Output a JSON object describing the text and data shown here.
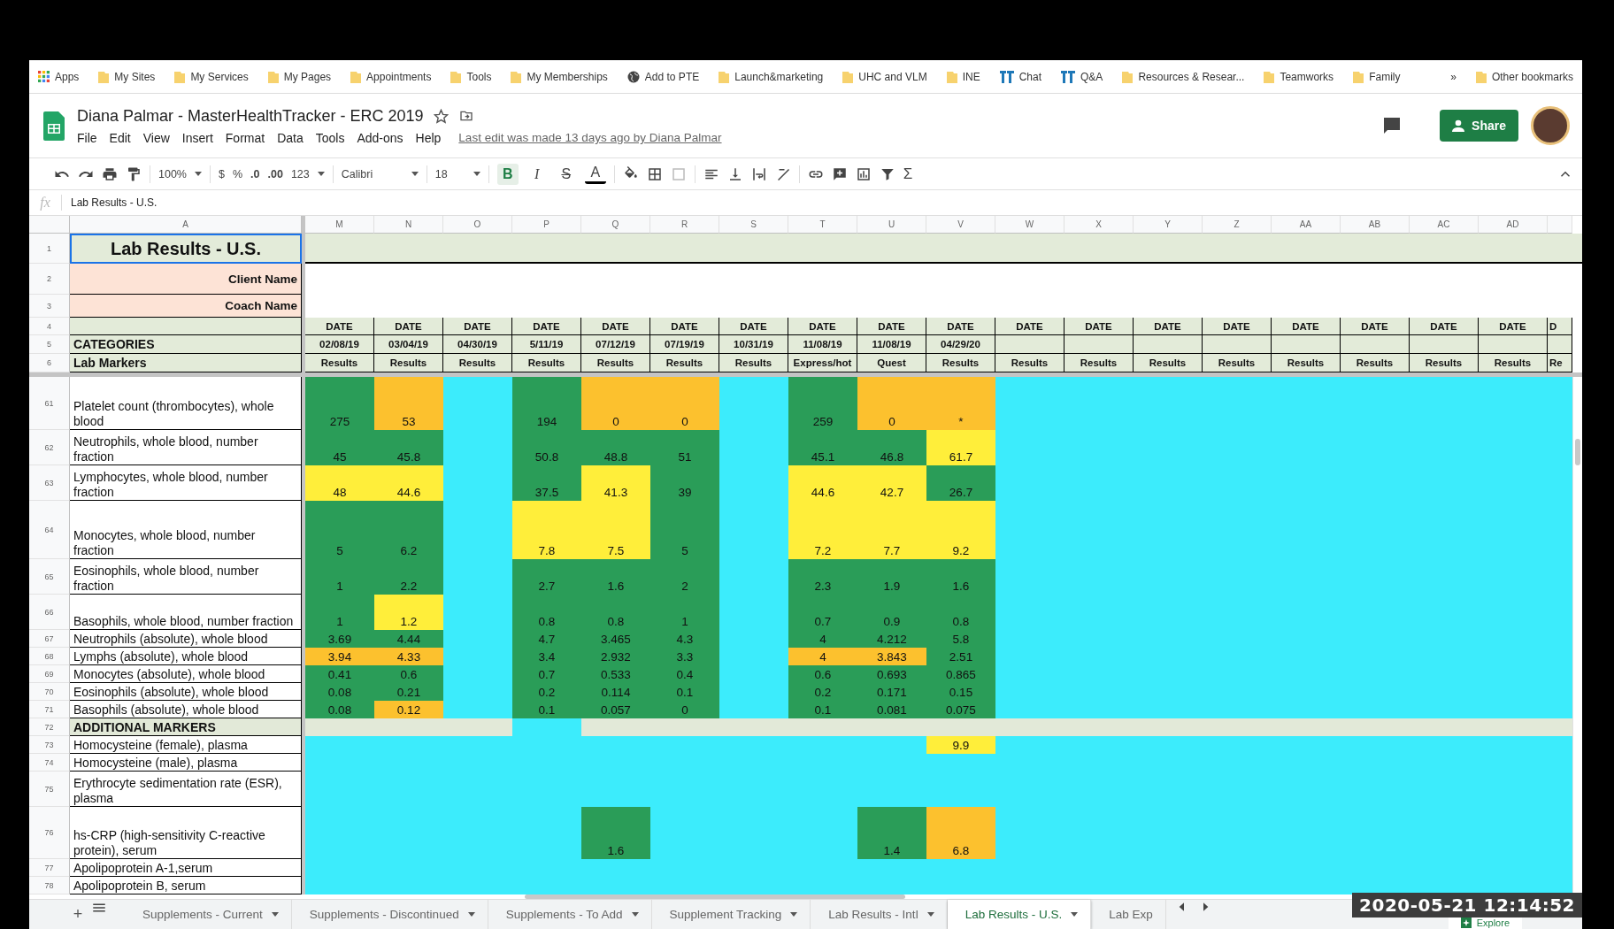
{
  "bookmarks": [
    {
      "label": "Apps",
      "kind": "apps"
    },
    {
      "label": "My Sites",
      "kind": "folder"
    },
    {
      "label": "My Services",
      "kind": "folder"
    },
    {
      "label": "My Pages",
      "kind": "folder"
    },
    {
      "label": "Appointments",
      "kind": "folder"
    },
    {
      "label": "Tools",
      "kind": "folder"
    },
    {
      "label": "My Memberships",
      "kind": "folder"
    },
    {
      "label": "Add to PTE",
      "kind": "globe"
    },
    {
      "label": "Launch&marketing",
      "kind": "folder"
    },
    {
      "label": "UHC and VLM",
      "kind": "folder"
    },
    {
      "label": "INE",
      "kind": "folder"
    },
    {
      "label": "Chat",
      "kind": "app"
    },
    {
      "label": "Q&A",
      "kind": "app"
    },
    {
      "label": "Resources & Resear...",
      "kind": "folder"
    },
    {
      "label": "Teamworks",
      "kind": "folder"
    },
    {
      "label": "Family",
      "kind": "folder"
    }
  ],
  "bookmarks_more": "»",
  "other_bookmarks": "Other bookmarks",
  "document": {
    "title": "Diana Palmar - MasterHealthTracker - ERC 2019",
    "starred": false,
    "menu": [
      "File",
      "Edit",
      "View",
      "Insert",
      "Format",
      "Data",
      "Tools",
      "Add-ons",
      "Help"
    ],
    "last_edit": "Last edit was made 13 days ago by Diana Palmar"
  },
  "share": "Share",
  "toolbar": {
    "zoom": "100%",
    "currency": "$",
    "percent": "%",
    "decrease_decimals": ".0",
    "increase_decimals": ".00",
    "number_format": "123",
    "font": "Calibri",
    "font_size": "18",
    "format_buttons": [
      {
        "label": "B",
        "kind": "bold",
        "selected": true
      },
      {
        "label": "I",
        "kind": "italic",
        "selected": false
      },
      {
        "label": "S",
        "kind": "strike",
        "selected": false
      },
      {
        "label": "A",
        "kind": "text_color",
        "selected": false
      }
    ],
    "functions": "Σ"
  },
  "formula_bar": {
    "fx": "fx",
    "content": "Lab Results - U.S."
  },
  "sheet": {
    "column_a": "A",
    "title": "Lab Results - U.S.",
    "client_label": "Client Name",
    "coach_label": "Coach Name",
    "categories": "CATEGORIES",
    "lab_markers": "Lab Markers",
    "header_row_numbers": [
      "1",
      "2",
      "3",
      "4",
      "5",
      "6"
    ],
    "columns": [
      {
        "letter": "M",
        "top": "DATE",
        "date": "02/08/19",
        "sub": "Results"
      },
      {
        "letter": "N",
        "top": "DATE",
        "date": "03/04/19",
        "sub": "Results"
      },
      {
        "letter": "O",
        "top": "DATE",
        "date": "04/30/19",
        "sub": "Results"
      },
      {
        "letter": "P",
        "top": "DATE",
        "date": "5/11/19",
        "sub": "Results"
      },
      {
        "letter": "Q",
        "top": "DATE",
        "date": "07/12/19",
        "sub": "Results"
      },
      {
        "letter": "R",
        "top": "DATE",
        "date": "07/19/19",
        "sub": "Results"
      },
      {
        "letter": "S",
        "top": "DATE",
        "date": "10/31/19",
        "sub": "Results"
      },
      {
        "letter": "T",
        "top": "DATE",
        "date": "11/08/19",
        "sub": "Express/hot"
      },
      {
        "letter": "U",
        "top": "DATE",
        "date": "11/08/19",
        "sub": "Quest"
      },
      {
        "letter": "V",
        "top": "DATE",
        "date": "04/29/20",
        "sub": "Results"
      },
      {
        "letter": "W",
        "top": "DATE",
        "sub": "Results"
      },
      {
        "letter": "X",
        "top": "DATE",
        "sub": "Results"
      },
      {
        "letter": "Y",
        "top": "DATE",
        "sub": "Results"
      },
      {
        "letter": "Z",
        "top": "DATE",
        "sub": "Results"
      },
      {
        "letter": "AA",
        "top": "DATE",
        "sub": "Results"
      },
      {
        "letter": "AB",
        "top": "DATE",
        "sub": "Results"
      },
      {
        "letter": "AC",
        "top": "DATE",
        "sub": "Results"
      },
      {
        "letter": "AD",
        "top": "DATE",
        "sub": "Results"
      },
      {
        "top": "D",
        "sub": "Re"
      }
    ],
    "rows": [
      {
        "number": "61",
        "label": "Platelet count (thrombocytes), whole blood",
        "kind": "marker",
        "cells": [
          {
            "value": "275",
            "color": "#2a9d58"
          },
          {
            "value": "53",
            "color": "#fcc12e"
          },
          "",
          {
            "value": "194",
            "color": "#2a9d58"
          },
          {
            "value": "0",
            "color": "#fcc12e"
          },
          {
            "value": "0",
            "color": "#fcc12e"
          },
          "",
          {
            "value": "259",
            "color": "#2a9d58"
          },
          {
            "value": "0",
            "color": "#fcc12e"
          },
          {
            "value": "*",
            "color": "#fcc12e"
          }
        ]
      },
      {
        "number": "62",
        "label": "Neutrophils, whole blood, number fraction",
        "kind": "marker",
        "cells": [
          {
            "value": "45",
            "color": "#2a9d58"
          },
          {
            "value": "45.8",
            "color": "#2a9d58"
          },
          "",
          {
            "value": "50.8",
            "color": "#2a9d58"
          },
          {
            "value": "48.8",
            "color": "#2a9d58"
          },
          {
            "value": "51",
            "color": "#2a9d58"
          },
          "",
          {
            "value": "45.1",
            "color": "#2a9d58"
          },
          {
            "value": "46.8",
            "color": "#2a9d58"
          },
          {
            "value": "61.7",
            "color": "#ffee3a"
          }
        ]
      },
      {
        "number": "63",
        "label": "Lymphocytes, whole blood, number fraction",
        "kind": "marker",
        "cells": [
          {
            "value": "48",
            "color": "#ffee3a"
          },
          {
            "value": "44.6",
            "color": "#ffee3a"
          },
          "",
          {
            "value": "37.5",
            "color": "#2a9d58"
          },
          {
            "value": "41.3",
            "color": "#ffee3a"
          },
          {
            "value": "39",
            "color": "#2a9d58"
          },
          "",
          {
            "value": "44.6",
            "color": "#ffee3a"
          },
          {
            "value": "42.7",
            "color": "#ffee3a"
          },
          {
            "value": "26.7",
            "color": "#2a9d58"
          }
        ]
      },
      {
        "number": "64",
        "label": "Monocytes, whole blood, number fraction",
        "kind": "marker",
        "cells": [
          {
            "value": "5",
            "color": "#2a9d58"
          },
          {
            "value": "6.2",
            "color": "#2a9d58"
          },
          "",
          {
            "value": "7.8",
            "color": "#ffee3a"
          },
          {
            "value": "7.5",
            "color": "#ffee3a"
          },
          {
            "value": "5",
            "color": "#2a9d58"
          },
          "",
          {
            "value": "7.2",
            "color": "#ffee3a"
          },
          {
            "value": "7.7",
            "color": "#ffee3a"
          },
          {
            "value": "9.2",
            "color": "#ffee3a"
          }
        ]
      },
      {
        "number": "65",
        "label": "Eosinophils, whole blood, number fraction",
        "kind": "marker",
        "cells": [
          {
            "value": "1",
            "color": "#2a9d58"
          },
          {
            "value": "2.2",
            "color": "#2a9d58"
          },
          "",
          {
            "value": "2.7",
            "color": "#2a9d58"
          },
          {
            "value": "1.6",
            "color": "#2a9d58"
          },
          {
            "value": "2",
            "color": "#2a9d58"
          },
          "",
          {
            "value": "2.3",
            "color": "#2a9d58"
          },
          {
            "value": "1.9",
            "color": "#2a9d58"
          },
          {
            "value": "1.6",
            "color": "#2a9d58"
          }
        ]
      },
      {
        "number": "66",
        "label": "Basophils, whole blood, number fraction",
        "kind": "marker",
        "cells": [
          {
            "value": "1",
            "color": "#2a9d58"
          },
          {
            "value": "1.2",
            "color": "#ffee3a"
          },
          "",
          {
            "value": "0.8",
            "color": "#2a9d58"
          },
          {
            "value": "0.8",
            "color": "#2a9d58"
          },
          {
            "value": "1",
            "color": "#2a9d58"
          },
          "",
          {
            "value": "0.7",
            "color": "#2a9d58"
          },
          {
            "value": "0.9",
            "color": "#2a9d58"
          },
          {
            "value": "0.8",
            "color": "#2a9d58"
          }
        ]
      },
      {
        "number": "67",
        "label": "Neutrophils (absolute), whole blood",
        "kind": "marker",
        "cells": [
          {
            "value": "3.69",
            "color": "#2a9d58"
          },
          {
            "value": "4.44",
            "color": "#2a9d58"
          },
          "",
          {
            "value": "4.7",
            "color": "#2a9d58"
          },
          {
            "value": "3.465",
            "color": "#2a9d58"
          },
          {
            "value": "4.3",
            "color": "#2a9d58"
          },
          "",
          {
            "value": "4",
            "color": "#2a9d58"
          },
          {
            "value": "4.212",
            "color": "#2a9d58"
          },
          {
            "value": "5.8",
            "color": "#2a9d58"
          }
        ]
      },
      {
        "number": "68",
        "label": "Lymphs (absolute), whole blood",
        "kind": "marker",
        "cells": [
          {
            "value": "3.94",
            "color": "#fcc12e"
          },
          {
            "value": "4.33",
            "color": "#fcc12e"
          },
          "",
          {
            "value": "3.4",
            "color": "#2a9d58"
          },
          {
            "value": "2.932",
            "color": "#2a9d58"
          },
          {
            "value": "3.3",
            "color": "#2a9d58"
          },
          "",
          {
            "value": "4",
            "color": "#fcc12e"
          },
          {
            "value": "3.843",
            "color": "#fcc12e"
          },
          {
            "value": "2.51",
            "color": "#2a9d58"
          }
        ]
      },
      {
        "number": "69",
        "label": "Monocytes (absolute), whole blood",
        "kind": "marker",
        "cells": [
          {
            "value": "0.41",
            "color": "#2a9d58"
          },
          {
            "value": "0.6",
            "color": "#2a9d58"
          },
          "",
          {
            "value": "0.7",
            "color": "#2a9d58"
          },
          {
            "value": "0.533",
            "color": "#2a9d58"
          },
          {
            "value": "0.4",
            "color": "#2a9d58"
          },
          "",
          {
            "value": "0.6",
            "color": "#2a9d58"
          },
          {
            "value": "0.693",
            "color": "#2a9d58"
          },
          {
            "value": "0.865",
            "color": "#2a9d58"
          }
        ]
      },
      {
        "number": "70",
        "label": "Eosinophils (absolute), whole blood",
        "kind": "marker",
        "cells": [
          {
            "value": "0.08",
            "color": "#2a9d58"
          },
          {
            "value": "0.21",
            "color": "#2a9d58"
          },
          "",
          {
            "value": "0.2",
            "color": "#2a9d58"
          },
          {
            "value": "0.114",
            "color": "#2a9d58"
          },
          {
            "value": "0.1",
            "color": "#2a9d58"
          },
          "",
          {
            "value": "0.2",
            "color": "#2a9d58"
          },
          {
            "value": "0.171",
            "color": "#2a9d58"
          },
          {
            "value": "0.15",
            "color": "#2a9d58"
          }
        ]
      },
      {
        "number": "71",
        "label": "Basophils (absolute), whole blood",
        "kind": "marker",
        "cells": [
          {
            "value": "0.08",
            "color": "#2a9d58"
          },
          {
            "value": "0.12",
            "color": "#fcc12e"
          },
          "",
          {
            "value": "0.1",
            "color": "#2a9d58"
          },
          {
            "value": "0.057",
            "color": "#2a9d58"
          },
          {
            "value": "0",
            "color": "#2a9d58"
          },
          "",
          {
            "value": "0.1",
            "color": "#2a9d58"
          },
          {
            "value": "0.081",
            "color": "#2a9d58"
          },
          {
            "value": "0.075",
            "color": "#2a9d58"
          }
        ]
      },
      {
        "number": "72",
        "label": "ADDITIONAL MARKERS",
        "kind": "section",
        "cells": [
          "",
          "",
          "",
          {
            "color": "#3cecfc"
          }
        ]
      },
      {
        "number": "73",
        "label": "Homocysteine (female), plasma",
        "kind": "marker",
        "cells": [
          "",
          "",
          "",
          "",
          "",
          "",
          "",
          "",
          "",
          {
            "value": "9.9",
            "color": "#ffee3a"
          }
        ]
      },
      {
        "number": "74",
        "label": "Homocysteine (male), plasma",
        "kind": "marker",
        "cells": []
      },
      {
        "number": "75",
        "label": "Erythrocyte sedimentation rate (ESR), plasma",
        "kind": "marker",
        "cells": []
      },
      {
        "number": "76",
        "label": "hs-CRP (high-sensitivity C-reactive protein), serum",
        "kind": "marker",
        "cells": [
          "",
          "",
          "",
          "",
          {
            "value": "1.6",
            "color": "#2a9d58"
          },
          "",
          "",
          "",
          {
            "value": "1.4",
            "color": "#2a9d58"
          },
          {
            "value": "6.8",
            "color": "#fcc12e"
          }
        ]
      },
      {
        "number": "77",
        "label": "Apolipoprotein A-1,serum",
        "kind": "marker",
        "cells": []
      },
      {
        "number": "78",
        "label": "Apolipoprotein B, serum",
        "kind": "marker",
        "cells": []
      }
    ]
  },
  "tabs": [
    {
      "label": "Supplements - Current",
      "selected": false
    },
    {
      "label": "Supplements - Discontinued",
      "selected": false
    },
    {
      "label": "Supplements - To Add",
      "selected": false
    },
    {
      "label": "Supplement Tracking",
      "selected": false
    },
    {
      "label": "Lab Results - Intl",
      "selected": false
    },
    {
      "label": "Lab Results - U.S.",
      "selected": true
    },
    {
      "label": "Lab Exp",
      "selected": false
    }
  ],
  "add_sheet": "+",
  "explore": "Explore",
  "timestamp": "2020-05-21 12:14:52"
}
